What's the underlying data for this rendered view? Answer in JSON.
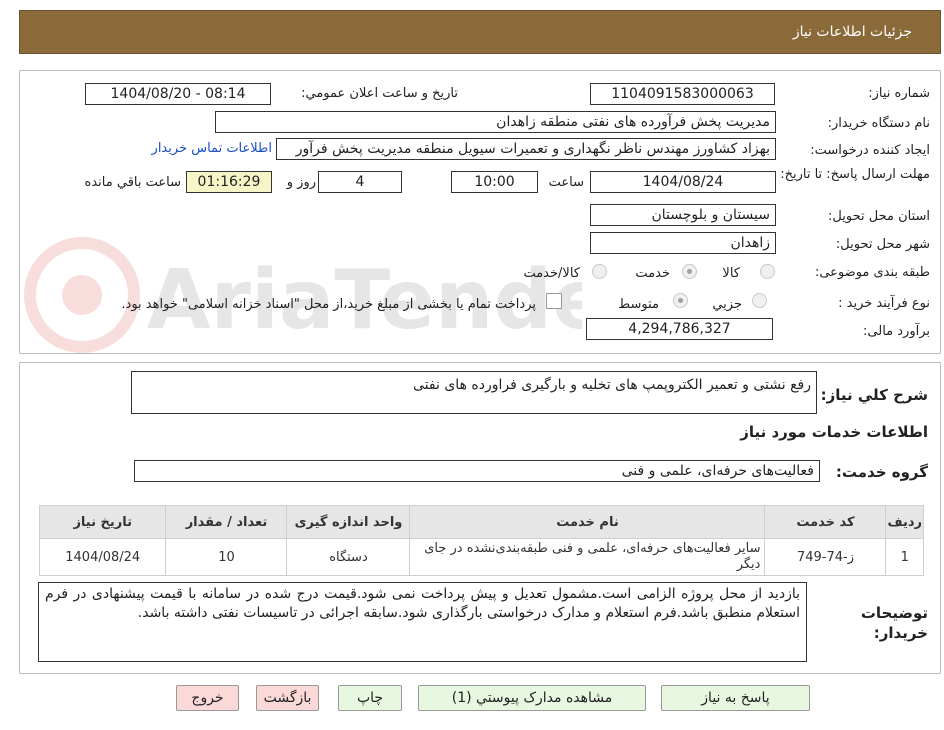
{
  "header": {
    "title": "جزئیات اطلاعات نیاز"
  },
  "need_number": {
    "label": "شماره نیاز:",
    "value": "1104091583000063"
  },
  "announce": {
    "label": "تاریخ و ساعت اعلان عمومي:",
    "value": "1404/08/20 - 08:14"
  },
  "buyer_org": {
    "label": "نام دستگاه خریدار:",
    "value": "مدیریت پخش فرآورده های نفتی منطقه زاهدان"
  },
  "requester": {
    "label": "ایجاد کننده درخواست:",
    "value": "بهزاد کشاورز مهندس ناظر نگهداری و تعمیرات سیویل منطقه  مدیریت پخش فرآور",
    "contact_link": "اطلاعات تماس خریدار"
  },
  "deadline": {
    "label": "مهلت ارسال پاسخ: تا تاریخ:",
    "date": "1404/08/24",
    "time_label": "ساعت",
    "time": "10:00",
    "days": "4",
    "days_label": "روز و",
    "remaining": "01:16:29",
    "remaining_label": "ساعت باقي مانده"
  },
  "province": {
    "label": "استان محل تحویل:",
    "value": "سیستان و بلوچستان"
  },
  "city": {
    "label": "شهر محل تحویل:",
    "value": "زاهدان"
  },
  "category": {
    "label": "طبقه بندی موضوعی:",
    "options": [
      "کالا",
      "خدمت",
      "کالا/خدمت"
    ],
    "selected": "خدمت"
  },
  "process": {
    "label": "نوع فرآیند خرید :",
    "options": [
      "جزیي",
      "متوسط"
    ],
    "selected": "متوسط",
    "note": "پرداخت تمام یا بخشی از مبلغ خرید،از محل \"اسناد خزانه اسلامی\" خواهد بود."
  },
  "estimate": {
    "label": "برآورد مالی:",
    "value": "4,294,786,327"
  },
  "summary": {
    "label": "شرح كلي نياز:",
    "value": "رفع نشتی و تعمیر الکتروپمپ های تخلیه و بارگیری فراورده های نفتی"
  },
  "services_heading": "اطلاعات خدمات مورد نیاز",
  "service_group": {
    "label": "گروه خدمت:",
    "value": "فعالیت‌های حرفه‌ای، علمی و فنی"
  },
  "table": {
    "headers": [
      "ردیف",
      "کد خدمت",
      "نام خدمت",
      "واحد اندازه گیری",
      "تعداد / مقدار",
      "تاریخ نیاز"
    ],
    "rows": [
      [
        "1",
        "ز-74-749",
        "سایر فعالیت‌های حرفه‌ای، علمی و فنی طبقه‌بندی‌نشده در جای دیگر",
        "دستگاه",
        "10",
        "1404/08/24"
      ]
    ]
  },
  "buyer_notes": {
    "label": "توضیحات خریدار:",
    "value": "بازدید از محل پروژه الزامی است.مشمول تعدیل و پیش پرداخت نمی شود.قیمت درج شده در سامانه با قیمت پیشنهادی در فرم استعلام منطبق باشد.فرم استعلام و مدارک درخواستی بارگذاری شود.سابقه اجرائی در تاسیسات نفتی داشته باشد."
  },
  "buttons": {
    "reply": "پاسخ به نیاز",
    "attachments": "مشاهده مدارک پیوستي (1)",
    "print": "چاپ",
    "back": "بازگشت",
    "exit": "خروج"
  },
  "colors": {
    "header_bg": "#8b6a3a",
    "remaining_bg": "#f5f5c8",
    "link": "#1a4fc4",
    "green_btn": "#e8f7e0",
    "pink_btn": "#fbd9d9"
  },
  "watermark": "AriaTender.neT"
}
